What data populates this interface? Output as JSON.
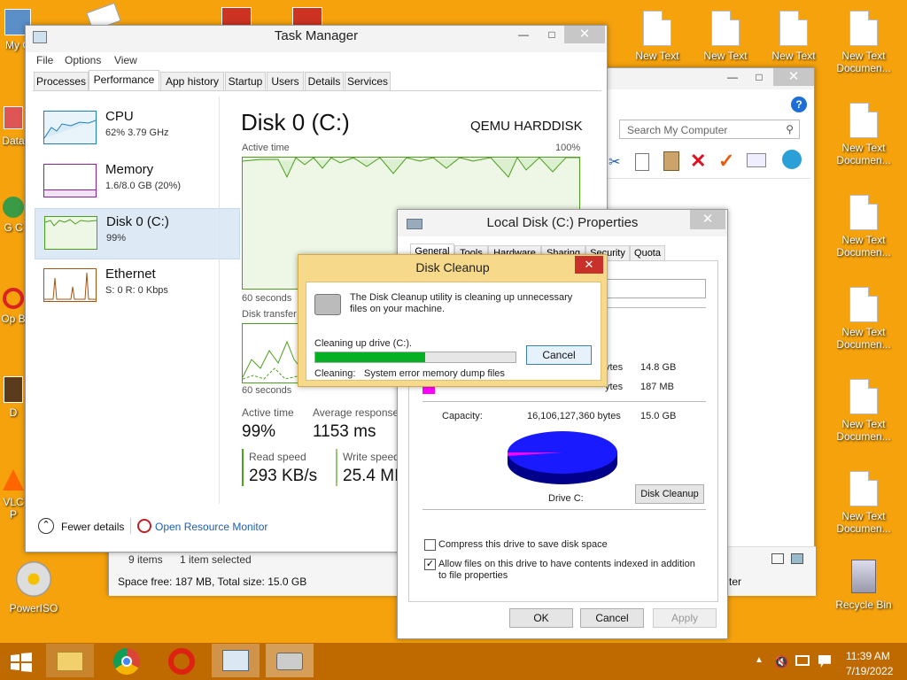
{
  "desktop": {
    "left_icons": [
      "My C",
      "Data",
      "G C",
      "Op B",
      "D",
      "VLC P",
      "PowerISO"
    ],
    "right_icons": [
      "New Text",
      "New Text",
      "New Text",
      "New Text Documen...",
      "New Text Documen...",
      "New Text Documen...",
      "New Text Documen...",
      "New Text Documen...",
      "New Text Documen...",
      "Recycle Bin"
    ]
  },
  "explorer": {
    "search_placeholder": "Search My Computer",
    "status_items": "9 items",
    "status_selected": "1 item selected",
    "space_free": "Space free: 187 MB, Total size: 15.0 GB",
    "right_text": "ter"
  },
  "task_manager": {
    "title": "Task Manager",
    "menu": [
      "File",
      "Options",
      "View"
    ],
    "tabs": [
      "Processes",
      "Performance",
      "App history",
      "Startup",
      "Users",
      "Details",
      "Services"
    ],
    "sidebar": [
      {
        "name": "CPU",
        "value": "62% 3.79 GHz",
        "color": "#1a7fc0"
      },
      {
        "name": "Memory",
        "value": "1.6/8.0 GB (20%)",
        "color": "#8a1f9e"
      },
      {
        "name": "Disk 0 (C:)",
        "value": "99%",
        "color": "#4da01e"
      },
      {
        "name": "Ethernet",
        "value": "S: 0 R: 0 Kbps",
        "color": "#a7530f"
      }
    ],
    "disk": {
      "title": "Disk 0 (C:)",
      "model": "QEMU HARDDISK",
      "active_time_label": "Active time",
      "pct_max": "100%",
      "seconds_label": "60 seconds",
      "transfer_label": "Disk transfer",
      "seconds_label2": "60 seconds",
      "active_time_stat_label": "Active time",
      "active_time_stat": "99%",
      "avg_response_label": "Average response",
      "avg_response": "1153 ms",
      "read_label": "Read speed",
      "read_value": "293 KB/s",
      "write_label": "Write speed",
      "write_value": "25.4 MI"
    },
    "fewer_details": "Fewer details",
    "open_monitor": "Open Resource Monitor"
  },
  "properties": {
    "title": "Local Disk (C:) Properties",
    "tabs": [
      "General",
      "Tools",
      "Hardware",
      "Sharing",
      "Security",
      "Quota"
    ],
    "used_bytes_suffix": "ytes",
    "used_size": "14.8 GB",
    "free_bytes_suffix": "ytes",
    "free_size": "187 MB",
    "capacity_label": "Capacity:",
    "capacity_bytes": "16,106,127,360 bytes",
    "capacity_size": "15.0 GB",
    "drive_label": "Drive C:",
    "cleanup_button": "Disk Cleanup",
    "compress_label": "Compress this drive to save disk space",
    "index_label": "Allow files on this drive to have contents indexed in addition to file properties",
    "ok": "OK",
    "cancel": "Cancel",
    "apply": "Apply",
    "used_color": "#1a1aff",
    "free_color": "#ff00ff"
  },
  "cleanup": {
    "title": "Disk Cleanup",
    "message": "The Disk Cleanup utility is cleaning up unnecessary files on your machine.",
    "drive_text": "Cleaning up drive  (C:).",
    "cleaning_label": "Cleaning:",
    "cleaning_item": "System error memory dump files",
    "cancel": "Cancel",
    "progress": 0.55
  },
  "taskbar": {
    "time": "11:39 AM",
    "date": "7/19/2022"
  }
}
